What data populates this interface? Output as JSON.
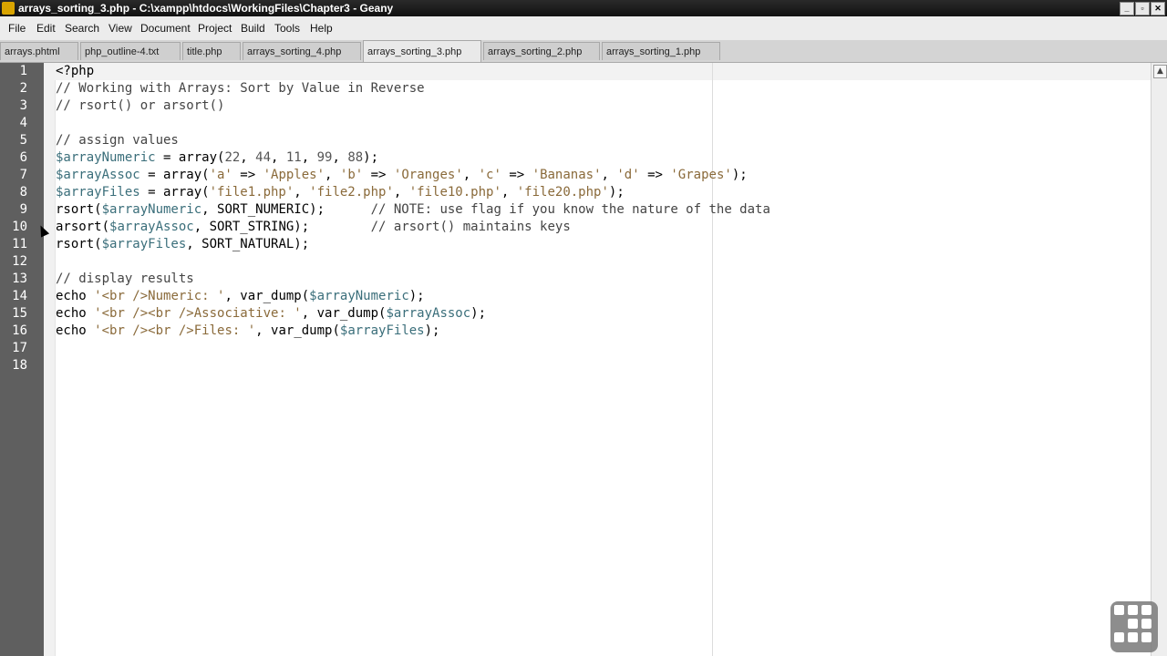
{
  "window": {
    "title": "arrays_sorting_3.php - C:\\xampp\\htdocs\\WorkingFiles\\Chapter3 - Geany",
    "minimize_glyph": "_",
    "maximize_glyph": "▫",
    "close_glyph": "✕"
  },
  "menu": {
    "items": [
      {
        "label": "File"
      },
      {
        "label": "Edit"
      },
      {
        "label": "Search"
      },
      {
        "label": "View"
      },
      {
        "label": "Document"
      },
      {
        "label": "Project"
      },
      {
        "label": "Build"
      },
      {
        "label": "Tools"
      },
      {
        "label": "Help"
      }
    ]
  },
  "tabs": [
    {
      "label": "arrays.phtml"
    },
    {
      "label": "php_outline-4.txt"
    },
    {
      "label": "title.php"
    },
    {
      "label": "arrays_sorting_4.php"
    },
    {
      "label": "arrays_sorting_3.php",
      "active": true
    },
    {
      "label": "arrays_sorting_2.php"
    },
    {
      "label": "arrays_sorting_1.php"
    }
  ],
  "editor": {
    "line_numbers": [
      "1",
      "2",
      "3",
      "4",
      "5",
      "6",
      "7",
      "8",
      "9",
      "10",
      "11",
      "12",
      "13",
      "14",
      "15",
      "16",
      "17",
      "18"
    ],
    "code_lines": [
      "<?php",
      "// Working with Arrays: Sort by Value in Reverse",
      "// rsort() or arsort()",
      "",
      "// assign values",
      "$arrayNumeric = array(22, 44, 11, 99, 88);",
      "$arrayAssoc = array('a' => 'Apples', 'b' => 'Oranges', 'c' => 'Bananas', 'd' => 'Grapes');",
      "$arrayFiles = array('file1.php', 'file2.php', 'file10.php', 'file20.php');",
      "rsort($arrayNumeric, SORT_NUMERIC);      // NOTE: use flag if you know the nature of the data",
      "arsort($arrayAssoc, SORT_STRING);        // arsort() maintains keys",
      "rsort($arrayFiles, SORT_NATURAL);",
      "",
      "// display results",
      "echo '<br />Numeric: ', var_dump($arrayNumeric);",
      "echo '<br /><br />Associative: ', var_dump($arrayAssoc);",
      "echo '<br /><br />Files: ', var_dump($arrayFiles);",
      "",
      ""
    ]
  },
  "colors": {
    "variable": "#3a6e7a",
    "string": "#8a6a3a",
    "comment": "#444444",
    "gutter": "#5f5f5f"
  }
}
